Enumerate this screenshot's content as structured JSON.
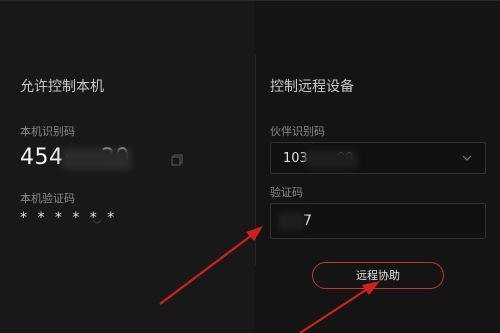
{
  "left": {
    "title": "允许控制本机",
    "id_label": "本机识别码",
    "id_value": "454·····29",
    "verify_label": "本机验证码",
    "verify_value": "* * * * * *"
  },
  "right": {
    "title": "控制远程设备",
    "partner_label": "伙伴识别码",
    "partner_value": "103·······00",
    "code_label": "验证码",
    "code_value": "7",
    "button_label": "远程协助"
  },
  "colors": {
    "accent": "#c0392b",
    "arrow": "#d0201c",
    "bg": "#151515"
  },
  "icons": {
    "copy": "copy-icon",
    "dropdown": "chevron-down-icon",
    "refresh": "refresh-icon"
  }
}
